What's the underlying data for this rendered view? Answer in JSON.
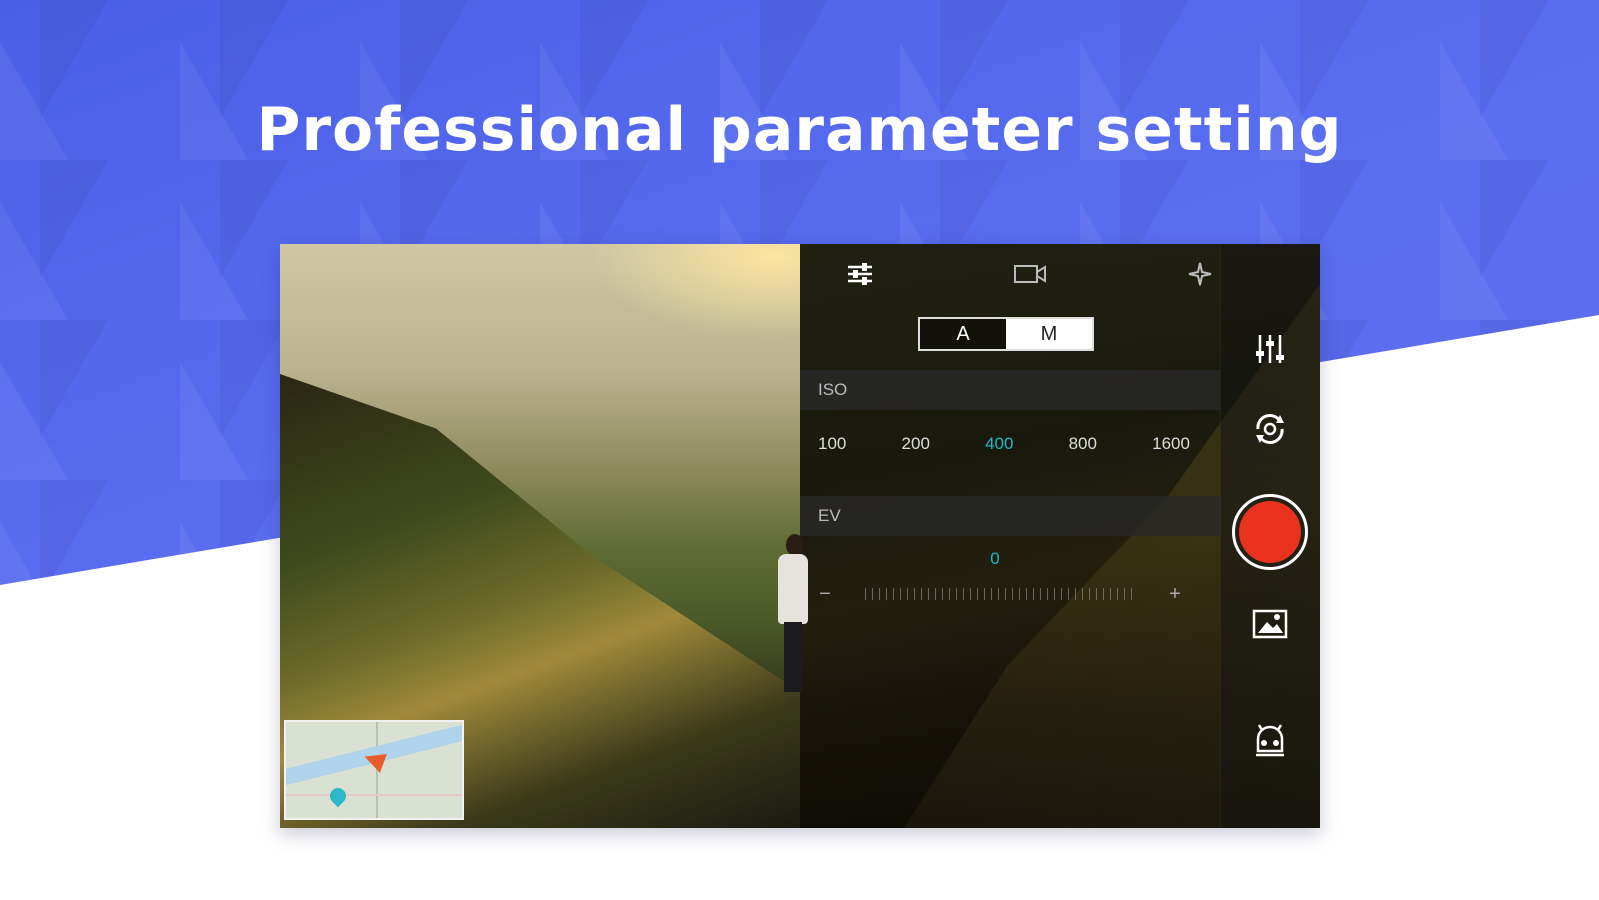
{
  "headline": "Professional parameter setting",
  "camera": {
    "tabs": [
      {
        "icon": "sliders-icon"
      },
      {
        "icon": "video-camera-icon"
      },
      {
        "icon": "sparkle-icon"
      }
    ],
    "mode_toggle": {
      "options": [
        "A",
        "M"
      ],
      "selected": "M"
    },
    "iso": {
      "label": "ISO",
      "values": [
        "100",
        "200",
        "400",
        "800",
        "1600"
      ],
      "selected": "400"
    },
    "ev": {
      "label": "EV",
      "value": "0",
      "minus": "−",
      "plus": "+"
    },
    "rail_icons": [
      "equalizer-icon",
      "switch-camera-icon",
      "record-button",
      "gallery-icon",
      "gimbal-icon"
    ],
    "colors": {
      "accent": "#1fb8c9",
      "record": "#e8321e",
      "brand_blue": "#4a5fe8"
    }
  }
}
